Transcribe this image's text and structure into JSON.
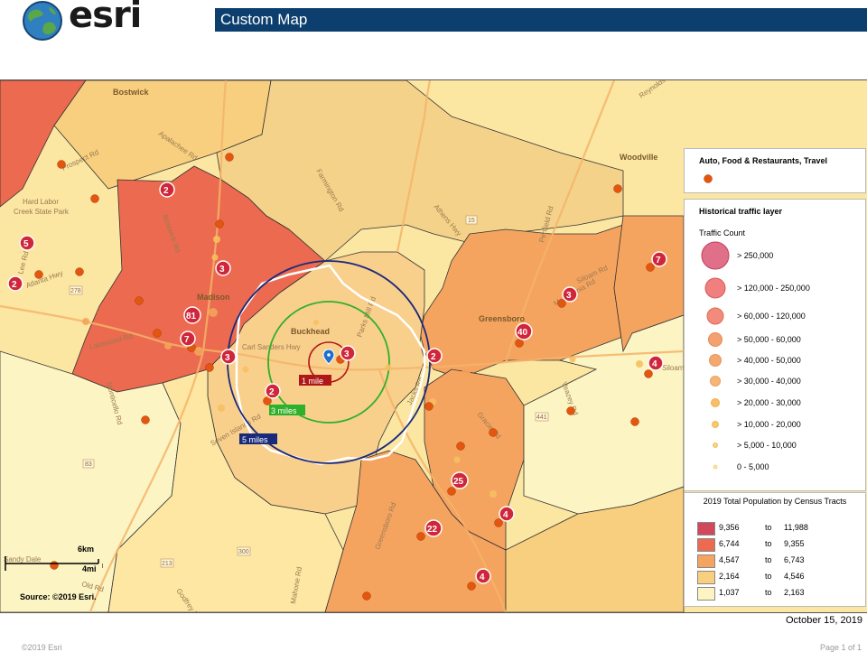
{
  "header": {
    "brand": "esri",
    "title": "Custom Map"
  },
  "map": {
    "places": [
      "Bostwick",
      "Madison",
      "Buckhead",
      "Greensboro",
      "Woodville",
      "Hard Labor",
      "Creek State Park",
      "Siloam"
    ],
    "roads": [
      "Apalachee Rd",
      "Bostwick Rd",
      "Prospect Rd",
      "Atlanta Hwy",
      "Lakewood Rd",
      "Carl Sanders Hwy",
      "Parks Mill Rd",
      "Athens Hwy",
      "Farmington Rd",
      "Penfield Rd",
      "Macedonia Rd",
      "Veazey Rd",
      "Monticello Rd",
      "Seven Islands Rd",
      "Jacks Rd",
      "Greensboro Rd",
      "Godfrey Rd",
      "Mahone Rd",
      "Gracie Rd",
      "Siloam Rd",
      "Sandy Dale",
      "Reynolds Rd",
      "Old Rd",
      "Lee Rd"
    ],
    "route_shields": [
      "15",
      "278",
      "83",
      "300",
      "213",
      "441"
    ],
    "rings": [
      "1 mile",
      "3 miles",
      "5 miles"
    ],
    "badges": [
      "2",
      "5",
      "2",
      "3",
      "81",
      "7",
      "3",
      "2",
      "3",
      "2",
      "40",
      "3",
      "7",
      "4",
      "25",
      "4",
      "22",
      "4"
    ]
  },
  "legend": {
    "business": {
      "title": "Auto, Food & Restaurants, Travel",
      "color": "#e2560f"
    },
    "traffic": {
      "title": "Historical traffic layer",
      "subtitle": "Traffic Count",
      "classes": [
        "> 250,000",
        "> 120,000 - 250,000",
        "> 60,000 - 120,000",
        "> 50,000 - 60,000",
        "> 40,000 - 50,000",
        "> 30,000 - 40,000",
        "> 20,000 - 30,000",
        "> 10,000 - 20,000",
        "> 5,000 - 10,000",
        "0 - 5,000"
      ]
    },
    "population": {
      "title": "2019 Total Population by Census Tracts",
      "rows": [
        {
          "lo": "9,356",
          "to": "to",
          "hi": "11,988",
          "color": "#d1485a"
        },
        {
          "lo": "6,744",
          "to": "to",
          "hi": "9,355",
          "color": "#ec6a4f"
        },
        {
          "lo": "4,547",
          "to": "to",
          "hi": "6,743",
          "color": "#f5a460"
        },
        {
          "lo": "2,164",
          "to": "to",
          "hi": "4,546",
          "color": "#f8cf7f"
        },
        {
          "lo": "1,037",
          "to": "to",
          "hi": "2,163",
          "color": "#fcf4c2"
        }
      ]
    }
  },
  "scale": {
    "km": "6km",
    "mi": "4mi"
  },
  "source": "Source: ©2019 Esri.",
  "date": "October 15, 2019",
  "footer": {
    "left": "©2019 Esri",
    "right": "Page 1 of 1"
  }
}
